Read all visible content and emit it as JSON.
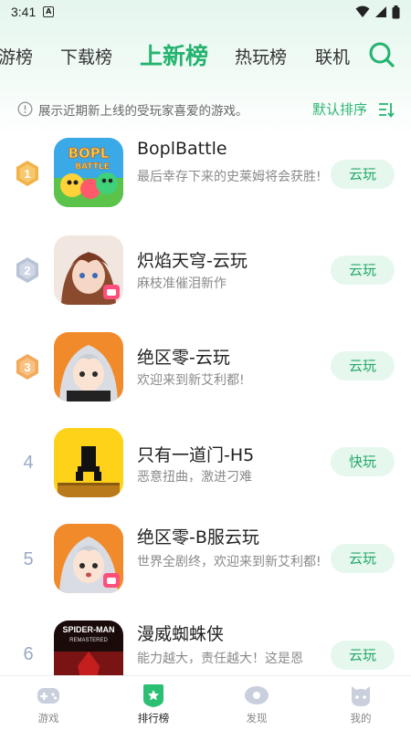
{
  "status_bar": {
    "time": "3:41",
    "notif_icon": "A"
  },
  "tabs": [
    {
      "label": "游榜",
      "active": false
    },
    {
      "label": "下载榜",
      "active": false
    },
    {
      "label": "上新榜",
      "active": true
    },
    {
      "label": "热玩榜",
      "active": false
    },
    {
      "label": "联机",
      "active": false
    }
  ],
  "hint": {
    "text": "展示近期新上线的受玩家喜爱的游戏。",
    "sort_label": "默认排序"
  },
  "colors": {
    "accent": "#24b36f",
    "button_bg": "#e6f7ee",
    "gold": "#f2b24a",
    "silver": "#b9c3d6",
    "bronze": "#f3a95a"
  },
  "games": [
    {
      "rank": "1",
      "title": "BoplBattle",
      "desc": "最后幸存下来的史莱姆将会获胜!",
      "button": "云玩"
    },
    {
      "rank": "2",
      "title": "炽焰天穹-云玩",
      "desc": "麻枝准催泪新作",
      "button": "云玩"
    },
    {
      "rank": "3",
      "title": "绝区零-云玩",
      "desc": "欢迎来到新艾利都!",
      "button": "云玩"
    },
    {
      "rank": "4",
      "title": "只有一道门-H5",
      "desc": "恶意扭曲，激进刁难",
      "button": "快玩"
    },
    {
      "rank": "5",
      "title": "绝区零-B服云玩",
      "desc": "世界全剧终，欢迎来到新艾利都!",
      "button": "云玩"
    },
    {
      "rank": "6",
      "title": "漫威蜘蛛侠",
      "desc": "能力越大，责任越大！这是恩",
      "button": "云玩"
    }
  ],
  "icon_art": {
    "bopl_line1": "BOPL",
    "bopl_line2": "BATTLE",
    "spider_line1": "SPIDER-MAN",
    "spider_line2": "REMASTERED"
  },
  "bottom_nav": [
    {
      "label": "游戏",
      "icon": "gamepad-icon",
      "active": false
    },
    {
      "label": "排行榜",
      "icon": "ranking-icon",
      "active": true
    },
    {
      "label": "发现",
      "icon": "discover-icon",
      "active": false
    },
    {
      "label": "我的",
      "icon": "profile-icon",
      "active": false
    }
  ]
}
